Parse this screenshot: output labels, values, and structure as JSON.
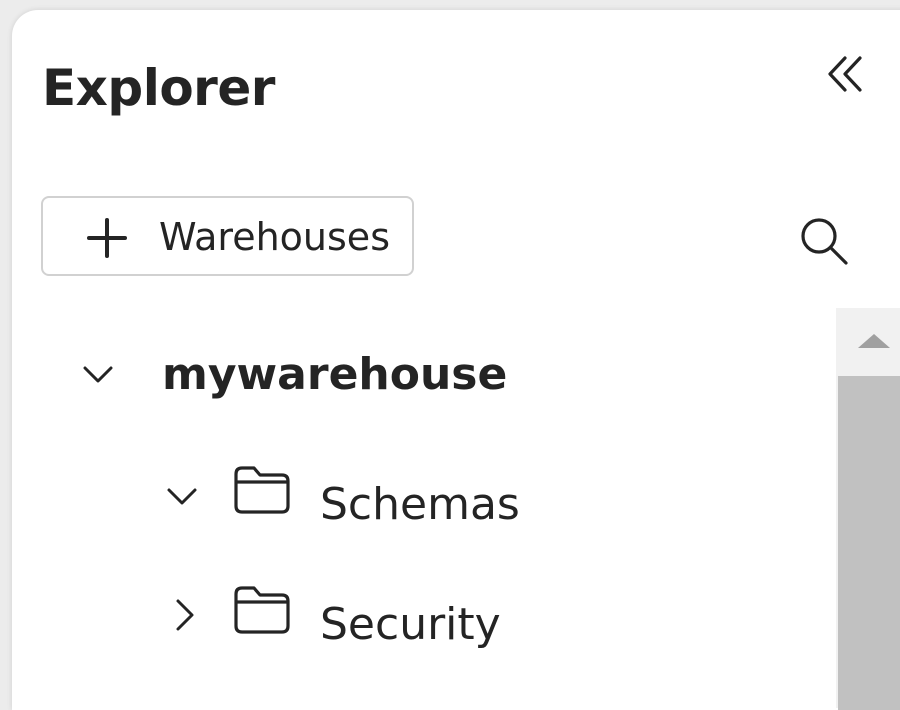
{
  "panel": {
    "title": "Explorer"
  },
  "toolbar": {
    "add_button_label": "Warehouses",
    "add_icon": "plus-icon",
    "search_icon": "search-icon",
    "collapse_icon": "double-chevron-left-icon"
  },
  "tree": {
    "items": [
      {
        "label": "mywarehouse",
        "expanded": true,
        "icon": "chevron-down-icon"
      },
      {
        "label": "Schemas",
        "expanded": true,
        "icon": "folder-icon"
      },
      {
        "label": "Security",
        "expanded": false,
        "icon": "folder-icon"
      }
    ]
  }
}
